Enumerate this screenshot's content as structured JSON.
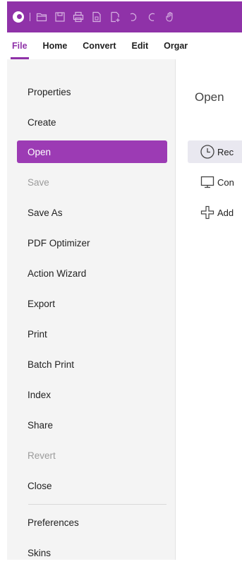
{
  "colors": {
    "accent": "#8f32a8",
    "sidebar_bg": "#f4f4f4",
    "active_item_bg": "#9c3bb4"
  },
  "titlebar": {
    "icons": [
      "app-logo-icon",
      "open-folder-icon",
      "save-icon",
      "print-icon",
      "file-icon",
      "new-file-icon",
      "undo-icon",
      "redo-icon",
      "hand-icon"
    ]
  },
  "menubar": {
    "items": [
      {
        "label": "File",
        "active": true
      },
      {
        "label": "Home"
      },
      {
        "label": "Convert"
      },
      {
        "label": "Edit"
      },
      {
        "label": "Orgar"
      }
    ]
  },
  "sidebar": {
    "items": [
      {
        "label": "Properties"
      },
      {
        "label": "Create"
      },
      {
        "label": "Open",
        "active": true
      },
      {
        "label": "Save",
        "disabled": true
      },
      {
        "label": "Save As"
      },
      {
        "label": "PDF Optimizer"
      },
      {
        "label": "Action Wizard"
      },
      {
        "label": "Export"
      },
      {
        "label": "Print"
      },
      {
        "label": "Batch Print"
      },
      {
        "label": "Index"
      },
      {
        "label": "Share"
      },
      {
        "label": "Revert",
        "disabled": true
      },
      {
        "label": "Close"
      },
      {
        "label": "Preferences"
      },
      {
        "label": "Skins"
      }
    ]
  },
  "main": {
    "title": "Open",
    "options": [
      {
        "label": "Rec",
        "icon": "clock-icon",
        "selected": true
      },
      {
        "label": "Con",
        "icon": "computer-icon"
      },
      {
        "label": "Add",
        "icon": "add-place-icon"
      }
    ]
  }
}
